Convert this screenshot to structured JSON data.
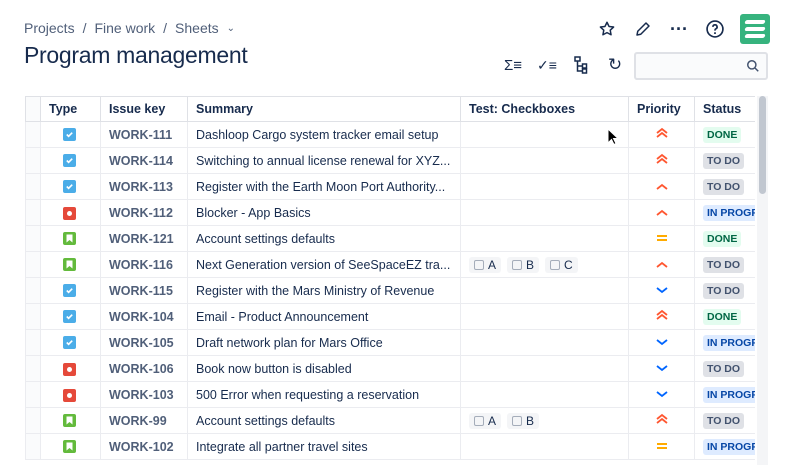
{
  "breadcrumbs": [
    "Projects",
    "Fine work",
    "Sheets"
  ],
  "page_title": "Program management",
  "search": {
    "placeholder": ""
  },
  "columns": [
    "Type",
    "Issue key",
    "Summary",
    "Test: Checkboxes",
    "Priority",
    "Status"
  ],
  "rows": [
    {
      "type": "task",
      "key": "WORK-111",
      "summary": "Dashloop Cargo system tracker email setup",
      "checkboxes": [],
      "priority": "highest",
      "status": "DONE"
    },
    {
      "type": "task",
      "key": "WORK-114",
      "summary": "Switching to annual license renewal for XYZ...",
      "checkboxes": [],
      "priority": "highest",
      "status": "TO DO"
    },
    {
      "type": "task",
      "key": "WORK-113",
      "summary": "Register with the Earth Moon Port Authority...",
      "checkboxes": [],
      "priority": "high",
      "status": "TO DO"
    },
    {
      "type": "bug",
      "key": "WORK-112",
      "summary": "Blocker - App Basics",
      "checkboxes": [],
      "priority": "high",
      "status": "IN PROGRESS"
    },
    {
      "type": "story",
      "key": "WORK-121",
      "summary": "Account settings defaults",
      "checkboxes": [],
      "priority": "medium",
      "status": "DONE"
    },
    {
      "type": "story",
      "key": "WORK-116",
      "summary": "Next Generation version of SeeSpaceEZ tra...",
      "checkboxes": [
        "A",
        "B",
        "C"
      ],
      "priority": "high",
      "status": "TO DO"
    },
    {
      "type": "task",
      "key": "WORK-115",
      "summary": "Register with the Mars Ministry of Revenue",
      "checkboxes": [],
      "priority": "low",
      "status": "TO DO"
    },
    {
      "type": "task",
      "key": "WORK-104",
      "summary": "Email - Product Announcement",
      "checkboxes": [],
      "priority": "highest",
      "status": "DONE"
    },
    {
      "type": "task",
      "key": "WORK-105",
      "summary": "Draft network plan for Mars Office",
      "checkboxes": [],
      "priority": "low",
      "status": "IN PROGRESS"
    },
    {
      "type": "bug",
      "key": "WORK-106",
      "summary": "Book now button is disabled",
      "checkboxes": [],
      "priority": "low",
      "status": "TO DO"
    },
    {
      "type": "bug",
      "key": "WORK-103",
      "summary": "500 Error when requesting a reservation",
      "checkboxes": [],
      "priority": "low",
      "status": "IN PROGRESS"
    },
    {
      "type": "story",
      "key": "WORK-99",
      "summary": "Account settings defaults",
      "checkboxes": [
        "A",
        "B"
      ],
      "priority": "highest",
      "status": "TO DO"
    },
    {
      "type": "story",
      "key": "WORK-102",
      "summary": "Integrate all partner travel sites",
      "checkboxes": [],
      "priority": "medium",
      "status": "IN PROGRESS"
    }
  ]
}
